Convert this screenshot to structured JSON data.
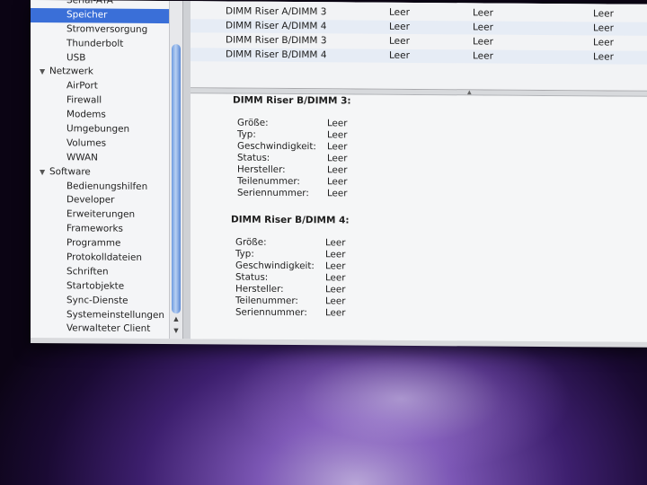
{
  "sidebar": {
    "rows": [
      {
        "label": "Serial-ATA",
        "type": "item"
      },
      {
        "label": "Speicher",
        "type": "item",
        "selected": true
      },
      {
        "label": "Stromversorgung",
        "type": "item"
      },
      {
        "label": "Thunderbolt",
        "type": "item"
      },
      {
        "label": "USB",
        "type": "item"
      },
      {
        "label": "Netzwerk",
        "type": "category"
      },
      {
        "label": "AirPort",
        "type": "item"
      },
      {
        "label": "Firewall",
        "type": "item"
      },
      {
        "label": "Modems",
        "type": "item"
      },
      {
        "label": "Umgebungen",
        "type": "item"
      },
      {
        "label": "Volumes",
        "type": "item"
      },
      {
        "label": "WWAN",
        "type": "item"
      },
      {
        "label": "Software",
        "type": "category"
      },
      {
        "label": "Bedienungshilfen",
        "type": "item"
      },
      {
        "label": "Developer",
        "type": "item"
      },
      {
        "label": "Erweiterungen",
        "type": "item"
      },
      {
        "label": "Frameworks",
        "type": "item"
      },
      {
        "label": "Programme",
        "type": "item"
      },
      {
        "label": "Protokolldateien",
        "type": "item"
      },
      {
        "label": "Schriften",
        "type": "item"
      },
      {
        "label": "Startobjekte",
        "type": "item"
      },
      {
        "label": "Sync-Dienste",
        "type": "item"
      },
      {
        "label": "Systemeinstellungen",
        "type": "item"
      },
      {
        "label": "Verwalteter Client",
        "type": "item"
      }
    ],
    "disclosure_icon": "triangle-down-icon",
    "scroll_up_glyph": "▲",
    "scroll_down_glyph": "▼"
  },
  "memory_table": {
    "rows": [
      {
        "slot": "DIMM Riser A/DIMM 3",
        "size": "Leer",
        "type": "Leer",
        "speed": "Leer"
      },
      {
        "slot": "DIMM Riser A/DIMM 4",
        "size": "Leer",
        "type": "Leer",
        "speed": "Leer"
      },
      {
        "slot": "DIMM Riser B/DIMM 3",
        "size": "Leer",
        "type": "Leer",
        "speed": "Leer"
      },
      {
        "slot": "DIMM Riser B/DIMM 4",
        "size": "Leer",
        "type": "Leer",
        "speed": "Leer"
      }
    ]
  },
  "details": {
    "sections": [
      {
        "title": "DIMM Riser B/DIMM 3:",
        "fields": [
          {
            "label": "Größe:",
            "value": "Leer"
          },
          {
            "label": "Typ:",
            "value": "Leer"
          },
          {
            "label": "Geschwindigkeit:",
            "value": "Leer"
          },
          {
            "label": "Status:",
            "value": "Leer"
          },
          {
            "label": "Hersteller:",
            "value": "Leer"
          },
          {
            "label": "Teilenummer:",
            "value": "Leer"
          },
          {
            "label": "Seriennummer:",
            "value": "Leer"
          }
        ]
      },
      {
        "title": "DIMM Riser B/DIMM 4:",
        "fields": [
          {
            "label": "Größe:",
            "value": "Leer"
          },
          {
            "label": "Typ:",
            "value": "Leer"
          },
          {
            "label": "Geschwindigkeit:",
            "value": "Leer"
          },
          {
            "label": "Status:",
            "value": "Leer"
          },
          {
            "label": "Hersteller:",
            "value": "Leer"
          },
          {
            "label": "Teilenummer:",
            "value": "Leer"
          },
          {
            "label": "Seriennummer:",
            "value": "Leer"
          }
        ]
      }
    ]
  },
  "colors": {
    "selection": "#3a6fd8",
    "desktop": "#4a2a7e",
    "table_alt": "#e6ecf5"
  }
}
